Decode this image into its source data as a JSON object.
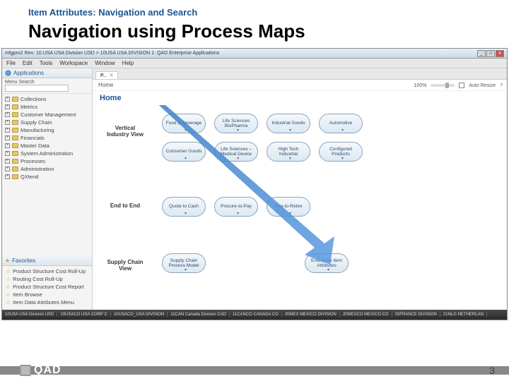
{
  "slide": {
    "header": "Item Attributes: Navigation and Search",
    "title": "Navigation using Process Maps",
    "page_number": "3",
    "brand": "QAD"
  },
  "window": {
    "title": "mfgpro2 Rev: 10.USA USA Division USD > 10USA USA DIVISION 1: QAD Enterprise Applications",
    "menus": [
      "File",
      "Edit",
      "Tools",
      "Workspace",
      "Window",
      "Help"
    ]
  },
  "sidebar": {
    "apps_header": "Applications",
    "menu_search_label": "Menu Search",
    "tree": [
      "Collections",
      "Metrics",
      "Customer Management",
      "Supply Chain",
      "Manufacturing",
      "Financials",
      "Master Data",
      "System Administration",
      "Processes",
      "Administration",
      "QXtend"
    ],
    "fav_header": "Favorites",
    "favs": [
      "Product Structure Cost Roll-Up",
      "Routing Cost Roll-Up",
      "Product Structure Cost Report",
      "Item Browse",
      "Item Data Attributes Menu"
    ]
  },
  "main": {
    "tab": "P...",
    "breadcrumb": "Home",
    "home": "Home",
    "zoom": "100%",
    "auto_resize": "Auto Resize",
    "rows": {
      "r1": "Vertical Industry View",
      "r2": "End to End",
      "r3": "Supply Chain View"
    },
    "nodes": {
      "n11": "Food & Beverage",
      "n12": "Life Sciences BioPharma",
      "n13": "Industrial Goods",
      "n14": "Automotive",
      "n21": "Consumer Goods",
      "n22": "Life Sciences – Medical Device",
      "n23": "High Tech Industrial",
      "n24": "Configured Products",
      "n31": "Quote to Cash",
      "n32": "Procure-to-Pay",
      "n33": "Hire-to-Retire",
      "n41": "Supply Chain Process Model",
      "n42": "Enterprise Item Attributes"
    }
  },
  "statusbar": {
    "s1": "10USA USA Division USD",
    "s2": "10USACO USA CORP C",
    "s3": "10USACO_USA DIVISION",
    "s4": "11CAN Canada Division CAD",
    "s5": "11CANCO CANADA CO",
    "s6": "20MEX MEXICO DIVISION",
    "s7": "20MEXCO MEXICO CO",
    "s8": "25FRANCE DIVISION",
    "s9": "21NLG NETHERLAN"
  }
}
